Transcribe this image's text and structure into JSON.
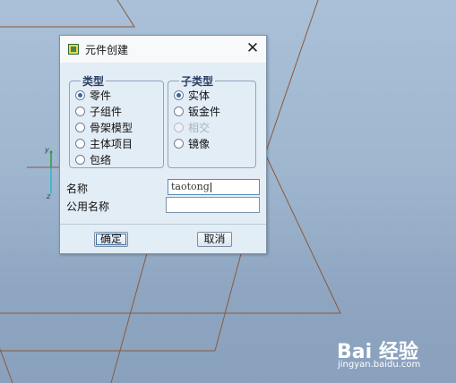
{
  "dialog": {
    "title": "元件创建",
    "type_group": {
      "legend": "类型",
      "options": [
        "零件",
        "子组件",
        "骨架模型",
        "主体项目",
        "包络"
      ],
      "selected": "零件"
    },
    "subtype_group": {
      "legend": "子类型",
      "options": [
        "实体",
        "钣金件",
        "相交",
        "镜像"
      ],
      "selected": "实体",
      "disabled": [
        "相交"
      ]
    },
    "name_label": "名称",
    "name_value": "taotong",
    "common_name_label": "公用名称",
    "common_name_value": "",
    "ok_label": "确定",
    "cancel_label": "取消"
  },
  "axes": {
    "y": "y",
    "z": "z"
  },
  "watermark": {
    "logo": "Bai 经验",
    "url": "jingyan.baidu.com"
  },
  "colors": {
    "datum_lines": "#8b5a3a",
    "background": "#9fb6cf",
    "accent": "#2f6aa8"
  }
}
